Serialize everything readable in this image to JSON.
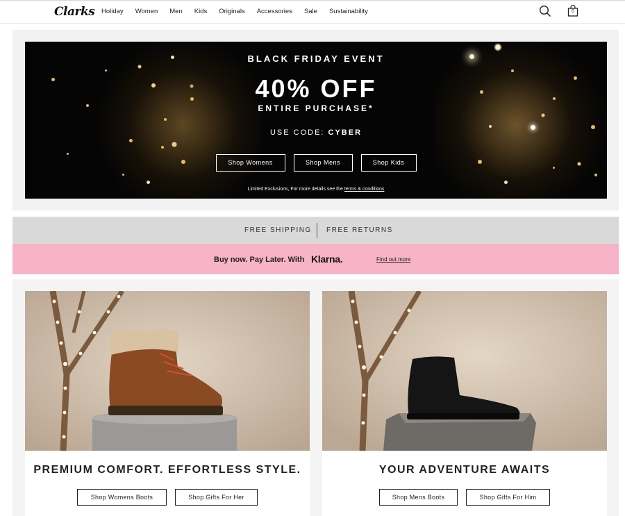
{
  "header": {
    "logo": "Clarks",
    "nav": [
      "Holiday",
      "Women",
      "Men",
      "Kids",
      "Originals",
      "Accessories",
      "Sale",
      "Sustainability"
    ],
    "icons": [
      "search-icon",
      "bag-icon"
    ],
    "bag_count": "0"
  },
  "hero": {
    "event": "BLACK FRIDAY EVENT",
    "offer": "40% OFF",
    "subtitle": "ENTIRE PURCHASE*",
    "code_label": "USE CODE:",
    "code": "CYBER",
    "buttons": [
      "Shop Womens",
      "Shop Mens",
      "Shop Kids"
    ],
    "disclaimer": "Limited Exclusions, For more details see the",
    "disclaimer_link": "terms & conditions"
  },
  "shipping": {
    "left": "FREE SHIPPING",
    "right": "FREE RETURNS"
  },
  "klarna": {
    "text": "Buy now. Pay Later. With",
    "brand": "Klarna.",
    "link": "Find out more",
    "bg_color": "#f7b3c7"
  },
  "cards": [
    {
      "title": "PREMIUM COMFORT. EFFORTLESS STYLE.",
      "buttons": [
        "Shop Womens Boots",
        "Shop Gifts For Her"
      ]
    },
    {
      "title": "YOUR ADVENTURE AWAITS",
      "buttons": [
        "Shop Mens Boots",
        "Shop Gifts For Him"
      ]
    }
  ]
}
